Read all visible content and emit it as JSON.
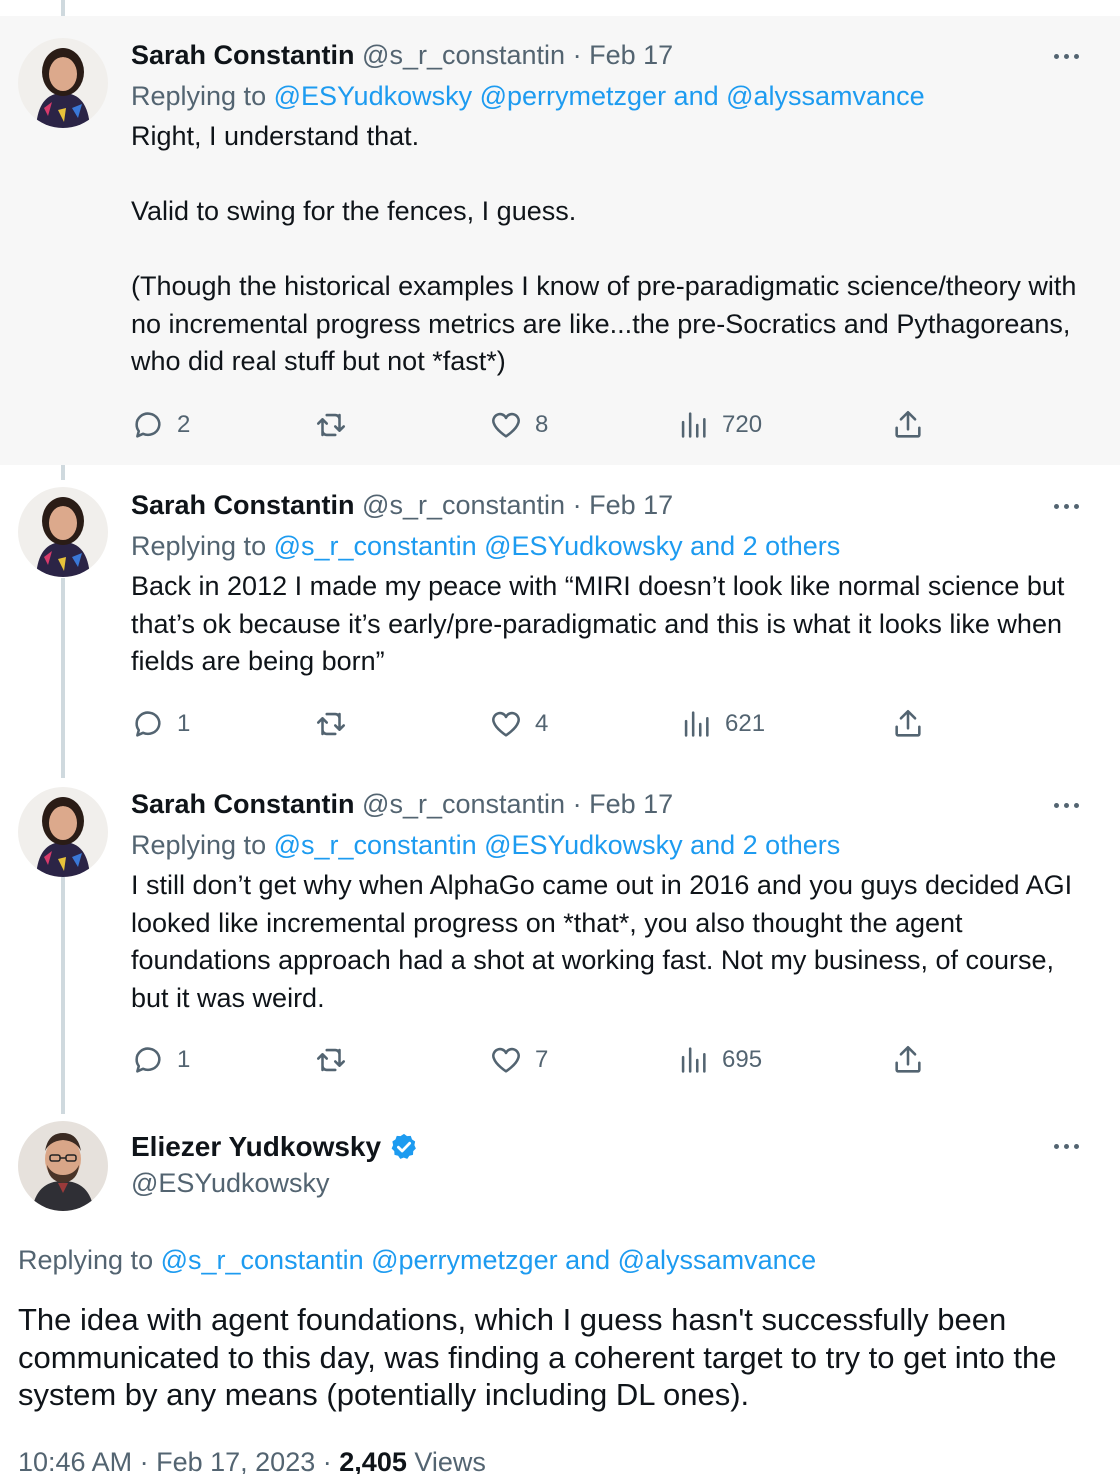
{
  "tweets": [
    {
      "name": "Sarah Constantin",
      "handle": "@s_r_constantin",
      "separator": "·",
      "date": "Feb 17",
      "replying_prefix": "Replying to",
      "replying_to": "@ESYudkowsky @perrymetzger and @alyssamvance",
      "paragraphs": [
        "Right, I understand that.",
        "Valid to swing for the fences, I guess.",
        "(Though the historical examples I know of pre-paradigmatic science/theory with no incremental progress metrics are like...the pre-Socratics and Pythagoreans, who did real stuff but not *fast*)"
      ],
      "replies": "2",
      "retweets": "",
      "likes": "8",
      "views": "720"
    },
    {
      "name": "Sarah Constantin",
      "handle": "@s_r_constantin",
      "separator": "·",
      "date": "Feb 17",
      "replying_prefix": "Replying to",
      "replying_to": "@s_r_constantin @ESYudkowsky and 2 others",
      "paragraphs": [
        "Back in 2012 I made my peace with “MIRI doesn’t look like normal science but that’s ok because it’s early/pre-paradigmatic and this is what it looks like when fields are being born”"
      ],
      "replies": "1",
      "retweets": "",
      "likes": "4",
      "views": "621"
    },
    {
      "name": "Sarah Constantin",
      "handle": "@s_r_constantin",
      "separator": "·",
      "date": "Feb 17",
      "replying_prefix": "Replying to",
      "replying_to": "@s_r_constantin @ESYudkowsky and 2 others",
      "paragraphs": [
        "I still don’t get why when AlphaGo came out in 2016 and you guys decided AGI looked like incremental progress on *that*, you also thought the agent foundations approach had a shot at working fast. Not my business, of course, but it was weird."
      ],
      "replies": "1",
      "retweets": "",
      "likes": "7",
      "views": "695"
    }
  ],
  "main": {
    "name": "Eliezer Yudkowsky",
    "verified_icon": "verified-badge-icon",
    "handle": "@ESYudkowsky",
    "replying_prefix": "Replying to",
    "replying_to": "@s_r_constantin @perrymetzger and @alyssamvance",
    "text": "The idea with agent foundations, which I guess hasn't successfully been communicated to this day, was finding a coherent target to try to get into the system by any means (potentially including DL ones).",
    "time": "10:46 AM",
    "separator": "·",
    "date": "Feb 17, 2023",
    "separator2": "·",
    "views_count": "2,405",
    "views_label": "Views"
  },
  "colors": {
    "link": "#1d9bf0",
    "secondary_text": "#536471",
    "primary_text": "#0f1419",
    "highlight_bg": "#f7f7f7",
    "thread_line": "#cfd9de"
  }
}
